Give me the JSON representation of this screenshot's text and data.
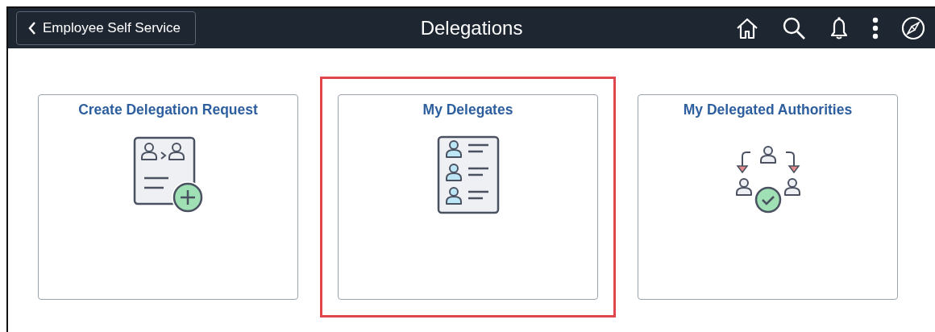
{
  "header": {
    "back_button": "Employee Self Service",
    "title": "Delegations"
  },
  "tiles": [
    {
      "title": "Create Delegation Request",
      "kind": "create",
      "highlighted": false
    },
    {
      "title": "My Delegates",
      "kind": "delegates",
      "highlighted": true
    },
    {
      "title": "My Delegated Authorities",
      "kind": "authorities",
      "highlighted": false
    }
  ]
}
